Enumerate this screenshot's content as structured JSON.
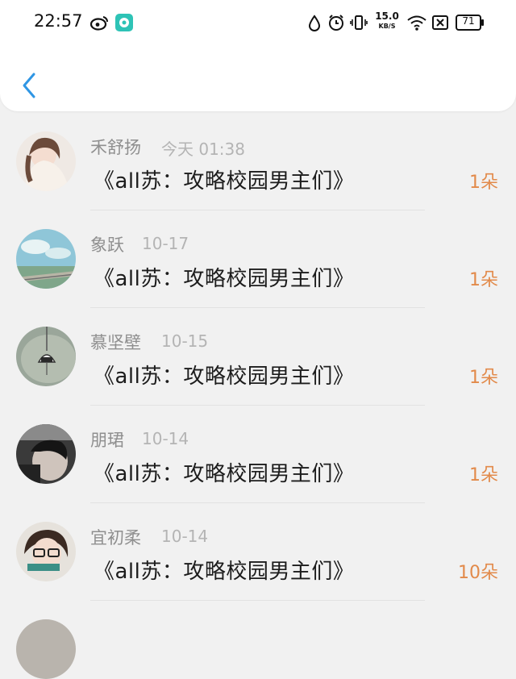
{
  "status": {
    "time": "22:57",
    "speed_value": "15.0",
    "speed_unit": "KB/S",
    "battery": "71"
  },
  "list": [
    {
      "name": "禾舒扬",
      "date": "今天 01:38",
      "book": "《all苏：攻略校园男主们》",
      "count": "1朵"
    },
    {
      "name": "象跃",
      "date": "10-17",
      "book": "《all苏：攻略校园男主们》",
      "count": "1朵"
    },
    {
      "name": "慕坚壁",
      "date": "10-15",
      "book": "《all苏：攻略校园男主们》",
      "count": "1朵"
    },
    {
      "name": "朋珺",
      "date": "10-14",
      "book": "《all苏：攻略校园男主们》",
      "count": "1朵"
    },
    {
      "name": "宜初柔",
      "date": "10-14",
      "book": "《all苏：攻略校园男主们》",
      "count": "10朵"
    }
  ],
  "colors": {
    "accent_count": "#e28a4a",
    "back_arrow": "#2f96e4"
  }
}
